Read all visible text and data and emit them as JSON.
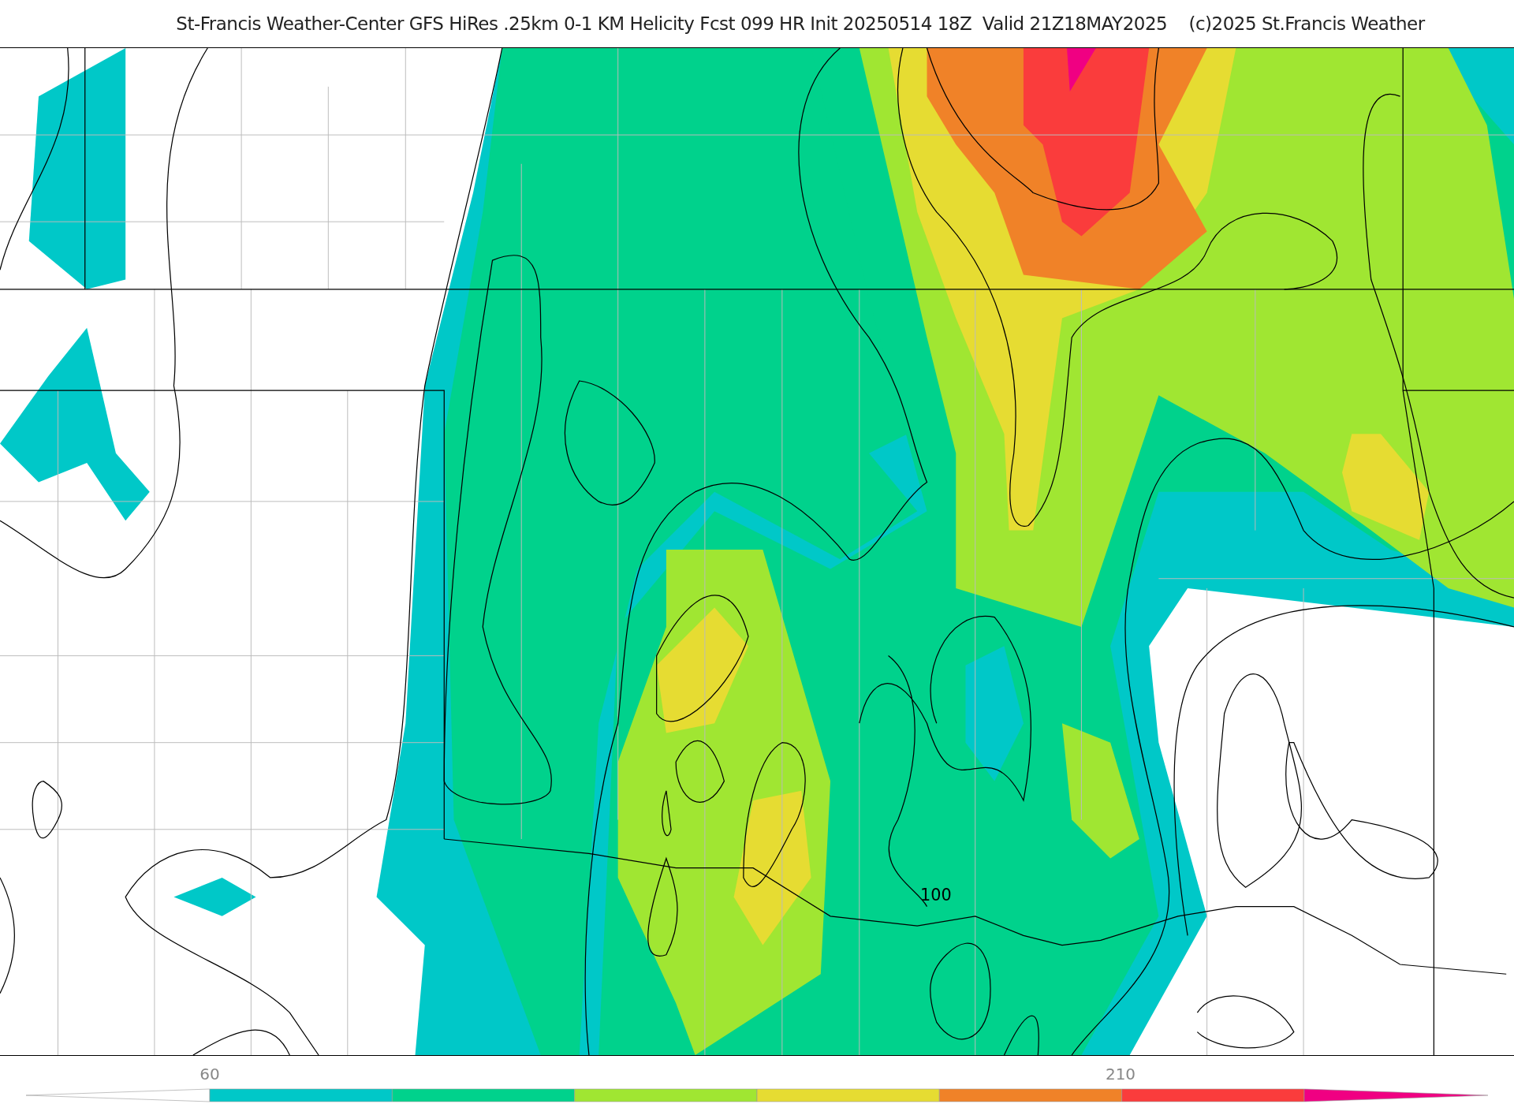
{
  "title": "St-Francis Weather-Center GFS HiRes .25km 0-1 KM Helicity Fcst 099 HR Init 20250514 18Z  Valid 21Z18MAY2025    (c)2025 St.Francis Weather",
  "map": {
    "contour_label": "100"
  },
  "colorbar": {
    "ticks": [
      {
        "label": "60"
      },
      {
        "label": "210"
      }
    ],
    "segments": [
      {
        "kind": "triangle-left",
        "color": "#ffffff"
      },
      {
        "kind": "box",
        "color": "#00c8c8"
      },
      {
        "kind": "box",
        "color": "#00d28c"
      },
      {
        "kind": "box",
        "color": "#a0e632"
      },
      {
        "kind": "box",
        "color": "#e6dc32"
      },
      {
        "kind": "box",
        "color": "#f08228"
      },
      {
        "kind": "box",
        "color": "#fa3c3c"
      },
      {
        "kind": "triangle-right",
        "color": "#f00082"
      }
    ]
  }
}
